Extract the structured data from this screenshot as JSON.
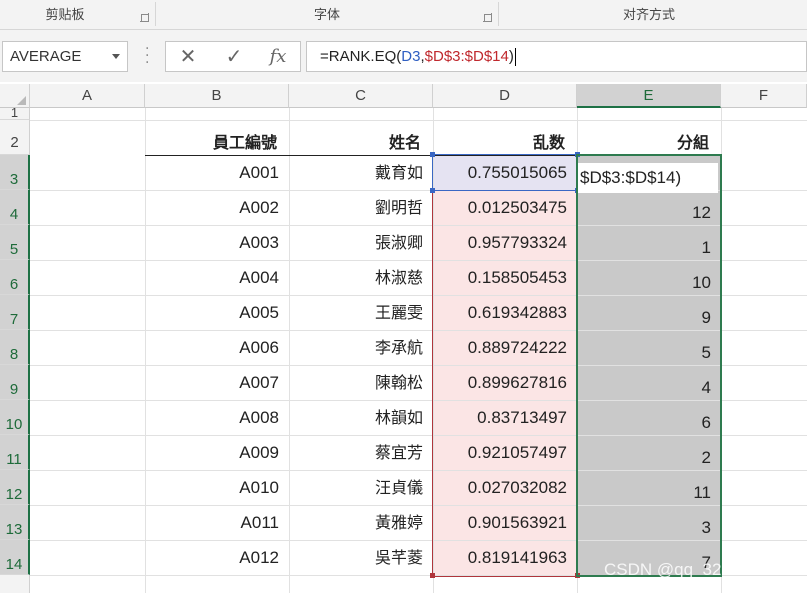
{
  "ribbon": {
    "groups": [
      {
        "label": "剪贴板"
      },
      {
        "label": "字体"
      },
      {
        "label": "对齐方式"
      }
    ]
  },
  "formula_bar": {
    "name_box": "AVERAGE",
    "cancel_symbol": "✕",
    "enter_symbol": "✓",
    "fx_label": "fx",
    "formula": {
      "prefix": "=RANK.EQ(",
      "arg1": "D3",
      "comma": ",",
      "arg2": "$D$3:$D$14",
      "suffix": ")"
    }
  },
  "sheet": {
    "columns": [
      "A",
      "B",
      "C",
      "D",
      "E",
      "F"
    ],
    "rows": [
      "1",
      "2",
      "3",
      "4",
      "5",
      "6",
      "7",
      "8",
      "9",
      "10",
      "11",
      "12",
      "13",
      "14"
    ],
    "headers": {
      "id": "員工編號",
      "name": "姓名",
      "random": "乱数",
      "group": "分組"
    },
    "records": [
      {
        "id": "A001",
        "name": "戴育如",
        "random": "0.755015065",
        "group": ""
      },
      {
        "id": "A002",
        "name": "劉明哲",
        "random": "0.012503475",
        "group": "12"
      },
      {
        "id": "A003",
        "name": "張淑卿",
        "random": "0.957793324",
        "group": "1"
      },
      {
        "id": "A004",
        "name": "林淑慈",
        "random": "0.158505453",
        "group": "10"
      },
      {
        "id": "A005",
        "name": "王麗雯",
        "random": "0.619342883",
        "group": "9"
      },
      {
        "id": "A006",
        "name": "李承航",
        "random": "0.889724222",
        "group": "5"
      },
      {
        "id": "A007",
        "name": "陳翰松",
        "random": "0.899627816",
        "group": "4"
      },
      {
        "id": "A008",
        "name": "林韻如",
        "random": "0.83713497",
        "group": "6"
      },
      {
        "id": "A009",
        "name": "蔡宜芳",
        "random": "0.921057497",
        "group": "2"
      },
      {
        "id": "A010",
        "name": "汪貞儀",
        "random": "0.027032082",
        "group": "11"
      },
      {
        "id": "A011",
        "name": "黃雅婷",
        "random": "0.901563921",
        "group": "3"
      },
      {
        "id": "A012",
        "name": "吳芊菱",
        "random": "0.819141963",
        "group": "7"
      }
    ],
    "editing_cell_text": "$D$3:$D$14)"
  },
  "watermark": "CSDN @qq_32833675",
  "colors": {
    "selection_green": "#2e7b4f",
    "ref_blue": "#3a67c4",
    "ref_red": "#b0353b",
    "range_fill": "#fbe5e5",
    "selected_fill": "#c9c9c9"
  }
}
